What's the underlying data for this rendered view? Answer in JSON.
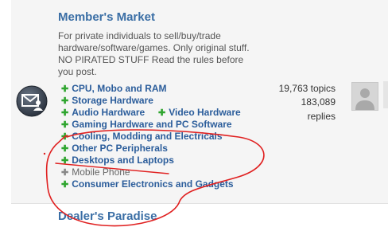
{
  "sections": [
    {
      "title": "Member's Market",
      "description": [
        "For private individuals to sell/buy/trade",
        "hardware/software/games. Only original stuff.",
        "NO PIRATED STUFF Read the rules before",
        "you post."
      ],
      "subforums": [
        "CPU, Mobo and RAM",
        "Storage Hardware",
        "Audio Hardware",
        "Video Hardware",
        "Gaming Hardware and PC Software",
        "Cooling, Modding and Electricals",
        "Other PC Peripherals",
        "Desktops and Laptops",
        "Mobile Phone",
        "Consumer Electronics and Gadgets"
      ],
      "topics": "19,763 topics",
      "replies_count": "183,089",
      "replies_label": "replies"
    },
    {
      "title": "Dealer's Paradise"
    }
  ],
  "colors": {
    "accent": "#3a6ea5",
    "link": "#2b5d9b",
    "plus": "#2fa52f",
    "annotation": "#e02020"
  },
  "icons": {
    "forum": "envelope-user-icon",
    "bullet": "plus-icon",
    "avatar": "default-avatar-icon"
  }
}
